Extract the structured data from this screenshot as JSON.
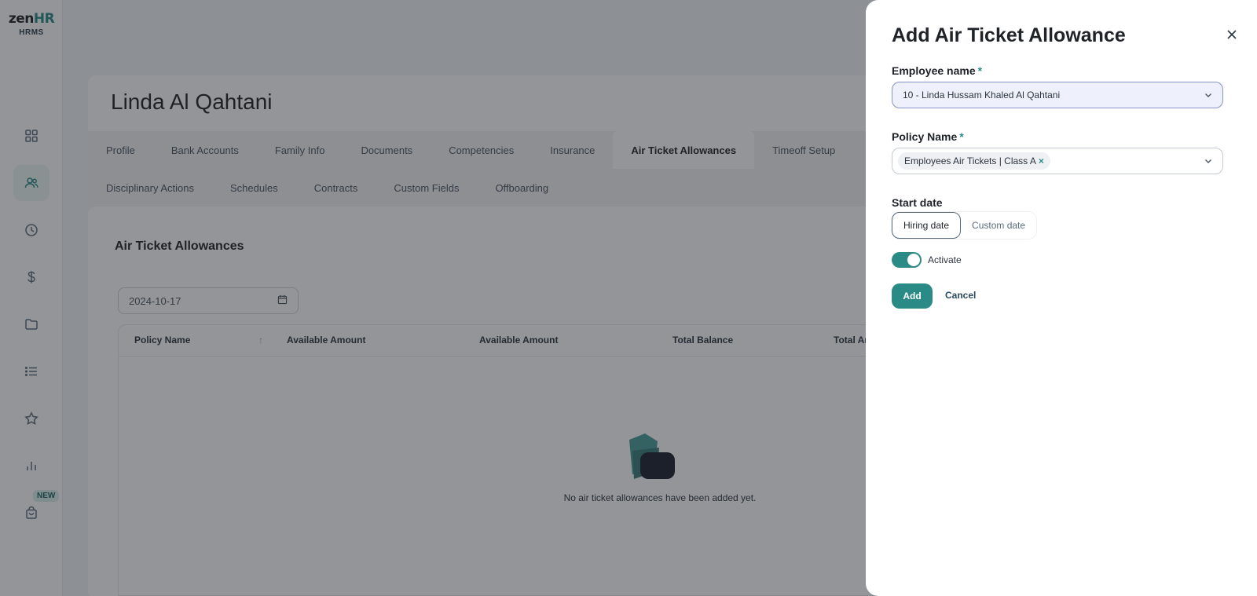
{
  "brand": {
    "logo_left": "zen",
    "logo_right": "HR",
    "sub": "HRMS"
  },
  "sidebar": {
    "items": [
      {
        "icon": "dashboard-icon"
      },
      {
        "icon": "employees-icon",
        "active": true
      },
      {
        "icon": "clock-icon"
      },
      {
        "icon": "dollar-icon"
      },
      {
        "icon": "folder-icon"
      },
      {
        "icon": "list-icon"
      },
      {
        "icon": "star-icon"
      },
      {
        "icon": "bar-chart-icon"
      },
      {
        "icon": "shopping-bag-icon"
      }
    ],
    "new_badge": "NEW"
  },
  "employee": {
    "name": "Linda Al Qahtani"
  },
  "tabs": {
    "row1": [
      "Profile",
      "Bank Accounts",
      "Family Info",
      "Documents",
      "Competencies",
      "Insurance",
      "Air Ticket Allowances",
      "Timeoff Setup"
    ],
    "row2": [
      "Disciplinary Actions",
      "Schedules",
      "Contracts",
      "Custom Fields",
      "Offboarding"
    ],
    "active": "Air Ticket Allowances"
  },
  "section": {
    "title": "Air Ticket Allowances",
    "date_value": "2024-10-17"
  },
  "table": {
    "headers": [
      "Policy Name",
      "Available Amount",
      "Available Amount",
      "Total Balance",
      "Total An"
    ],
    "empty_text": "No air ticket allowances have been added yet."
  },
  "drawer": {
    "title": "Add Air Ticket Allowance",
    "employee_label": "Employee name",
    "employee_value": "10 - Linda Hussam Khaled Al Qahtani",
    "policy_label": "Policy Name",
    "policy_tag": "Employees Air Tickets | Class A",
    "start_label": "Start date",
    "start_options": [
      "Hiring date",
      "Custom date"
    ],
    "start_selected": "Hiring date",
    "activate_label": "Activate",
    "activate_on": true,
    "add_label": "Add",
    "cancel_label": "Cancel",
    "required_mark": "*"
  },
  "colors": {
    "accent": "#2a8a86",
    "overlay": "#1e2228"
  }
}
